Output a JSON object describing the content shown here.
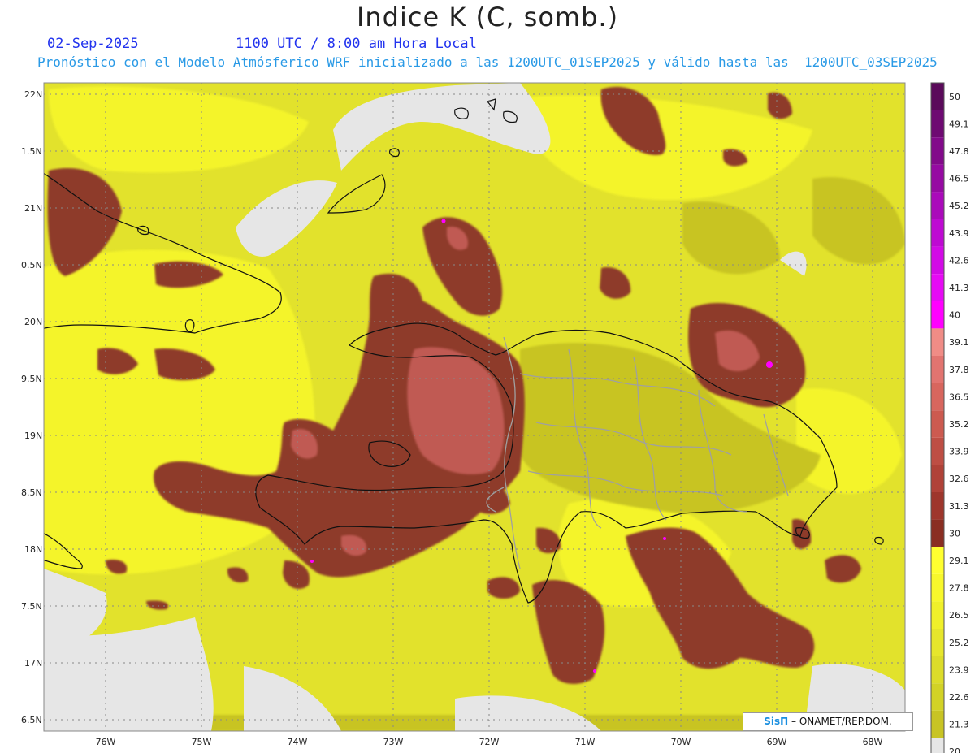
{
  "header": {
    "title": "Indice K (C, somb.)",
    "date": "02-Sep-2025",
    "time": "1100 UTC / 8:00 am Hora Local",
    "subtitle": "Pronóstico con el Modelo Atmósferico WRF inicializado a las 1200UTC_01SEP2025 y válido hasta las  1200UTC_03SEP2025"
  },
  "map": {
    "lat_labels": [
      "22N",
      "1.5N",
      "21N",
      "0.5N",
      "20N",
      "9.5N",
      "19N",
      "8.5N",
      "18N",
      "7.5N",
      "17N",
      "6.5N"
    ],
    "lon_labels": [
      "76W",
      "75W",
      "74W",
      "73W",
      "72W",
      "71W",
      "70W",
      "69W",
      "68W"
    ],
    "background_color": "#e6e6e6",
    "shade_colors": [
      "#c6c024",
      "#d6d62a",
      "#e2e22c",
      "#f0f02a",
      "#ffff30",
      "#8a3a26",
      "#a04a3a",
      "#c05a52",
      "#e87a7a",
      "#ff00ff",
      "#6a0a6a"
    ]
  },
  "colorbar": {
    "labels": [
      "50",
      "49.1",
      "47.8",
      "46.5",
      "45.2",
      "43.9",
      "42.6",
      "41.3",
      "40",
      "39.1",
      "37.8",
      "36.5",
      "35.2",
      "33.9",
      "32.6",
      "31.3",
      "30",
      "29.1",
      "27.8",
      "26.5",
      "25.2",
      "23.9",
      "22.6",
      "21.3",
      "20"
    ]
  },
  "credit": {
    "brand": "SisΠ",
    "text": "– ONAMET/REP.DOM."
  }
}
